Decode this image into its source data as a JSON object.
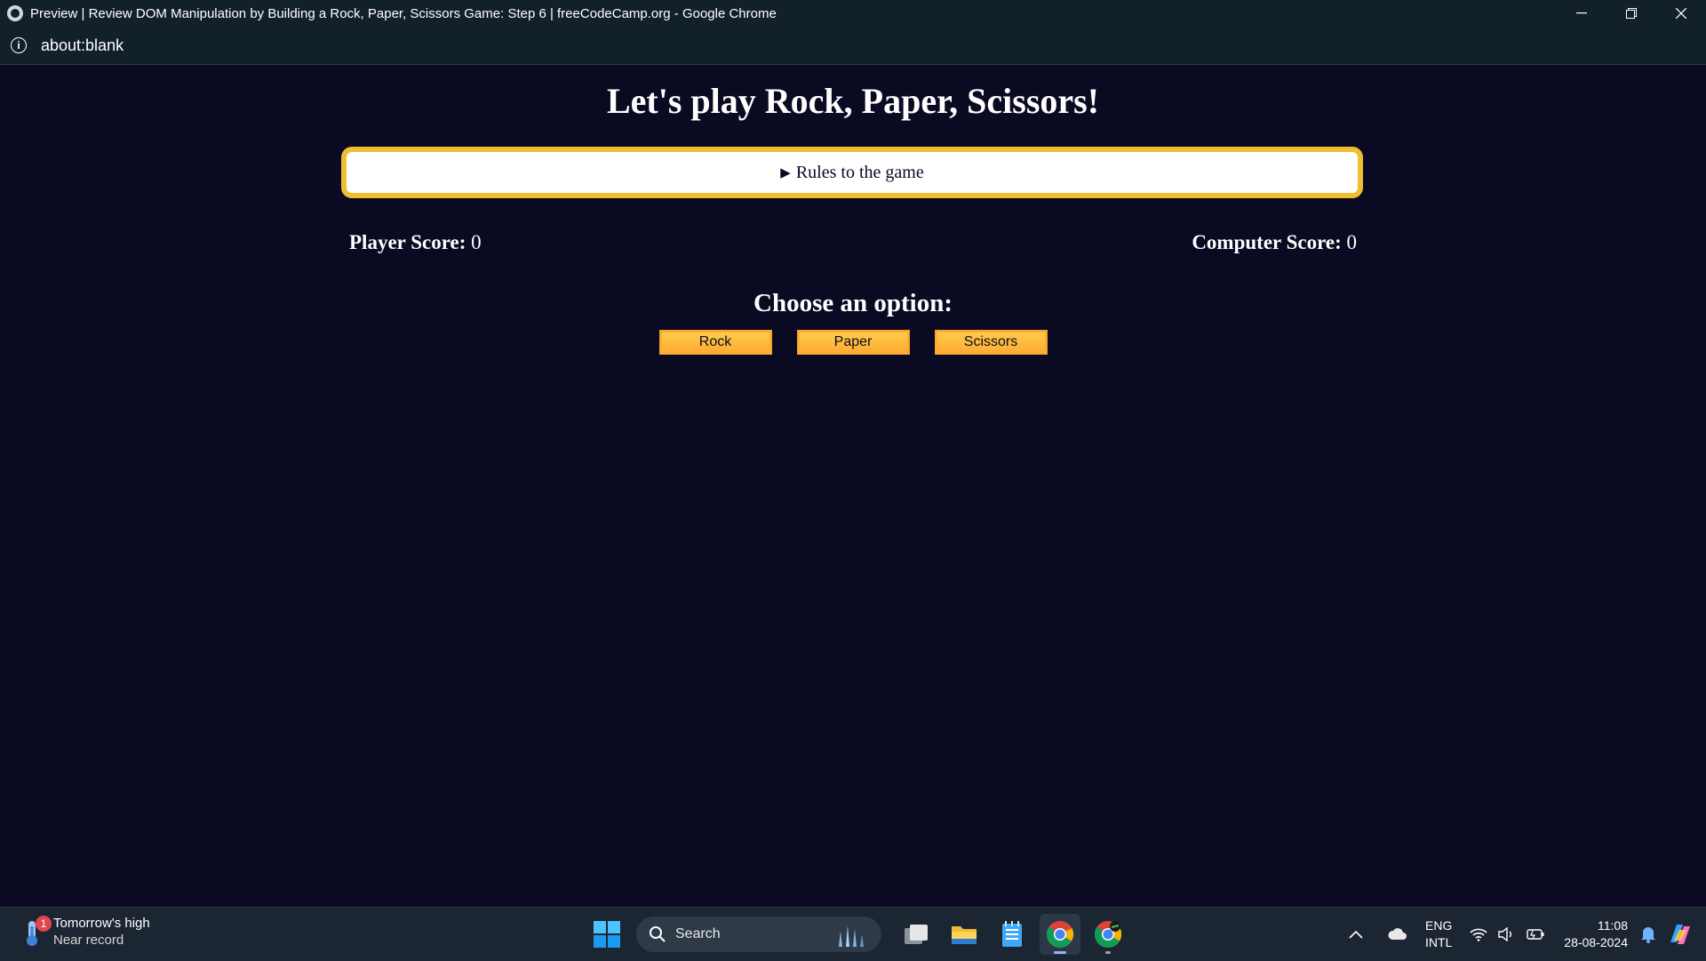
{
  "window": {
    "title": "Preview | Review DOM Manipulation by Building a Rock, Paper, Scissors Game: Step 6 | freeCodeCamp.org - Google Chrome",
    "url": "about:blank"
  },
  "page": {
    "heading": "Let's play Rock, Paper, Scissors!",
    "rules_summary": "Rules to the game",
    "player_score_label": "Player Score:",
    "player_score": "0",
    "computer_score_label": "Computer Score:",
    "computer_score": "0",
    "choose_label": "Choose an option:",
    "options": [
      "Rock",
      "Paper",
      "Scissors"
    ],
    "colors": {
      "background": "#0a0a23",
      "accent": "#f1be32",
      "button": "#feac32"
    }
  },
  "taskbar": {
    "weather_title": "Tomorrow's high",
    "weather_sub": "Near record",
    "weather_badge": "1",
    "search_placeholder": "Search",
    "lang_top": "ENG",
    "lang_bottom": "INTL",
    "time": "11:08",
    "date": "28-08-2024",
    "apps": [
      "task-view-icon",
      "file-explorer-icon",
      "notepad-icon",
      "chrome-icon",
      "chrome-profile-icon"
    ]
  }
}
